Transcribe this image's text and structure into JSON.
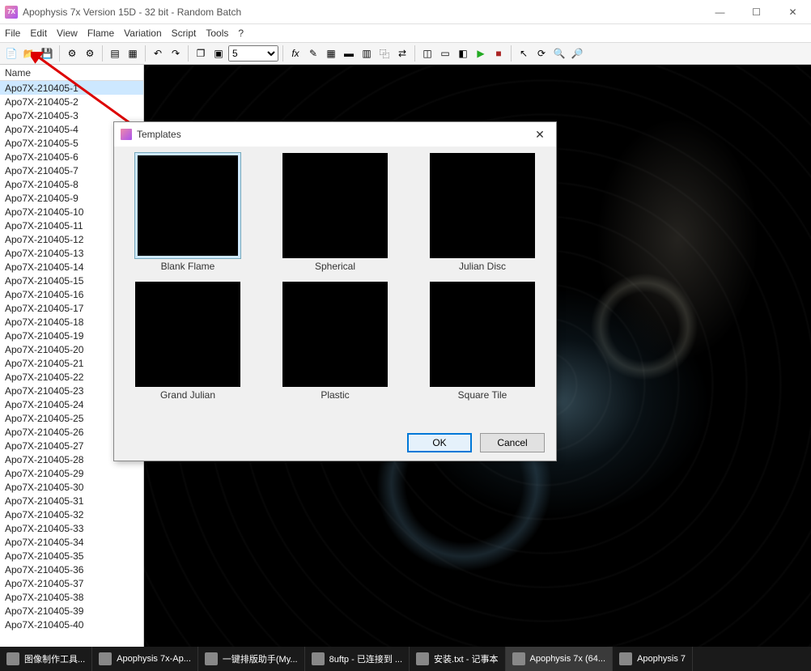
{
  "window": {
    "title": "Apophysis 7x Version 15D  - 32 bit - Random Batch"
  },
  "menubar": [
    "File",
    "Edit",
    "View",
    "Flame",
    "Variation",
    "Script",
    "Tools",
    "?"
  ],
  "toolbar": {
    "zoom_value": "5"
  },
  "sidebar": {
    "header": "Name",
    "selected_index": 0,
    "items": [
      "Apo7X-210405-1",
      "Apo7X-210405-2",
      "Apo7X-210405-3",
      "Apo7X-210405-4",
      "Apo7X-210405-5",
      "Apo7X-210405-6",
      "Apo7X-210405-7",
      "Apo7X-210405-8",
      "Apo7X-210405-9",
      "Apo7X-210405-10",
      "Apo7X-210405-11",
      "Apo7X-210405-12",
      "Apo7X-210405-13",
      "Apo7X-210405-14",
      "Apo7X-210405-15",
      "Apo7X-210405-16",
      "Apo7X-210405-17",
      "Apo7X-210405-18",
      "Apo7X-210405-19",
      "Apo7X-210405-20",
      "Apo7X-210405-21",
      "Apo7X-210405-22",
      "Apo7X-210405-23",
      "Apo7X-210405-24",
      "Apo7X-210405-25",
      "Apo7X-210405-26",
      "Apo7X-210405-27",
      "Apo7X-210405-28",
      "Apo7X-210405-29",
      "Apo7X-210405-30",
      "Apo7X-210405-31",
      "Apo7X-210405-32",
      "Apo7X-210405-33",
      "Apo7X-210405-34",
      "Apo7X-210405-35",
      "Apo7X-210405-36",
      "Apo7X-210405-37",
      "Apo7X-210405-38",
      "Apo7X-210405-39",
      "Apo7X-210405-40"
    ]
  },
  "dialog": {
    "title": "Templates",
    "ok_label": "OK",
    "cancel_label": "Cancel",
    "selected_index": 0,
    "templates": [
      {
        "label": "Blank Flame",
        "thumb": "th-blank"
      },
      {
        "label": "Spherical",
        "thumb": "th-spherical"
      },
      {
        "label": "Julian Disc",
        "thumb": "th-julian"
      },
      {
        "label": "Grand Julian",
        "thumb": "th-grand"
      },
      {
        "label": "Plastic",
        "thumb": "th-plastic"
      },
      {
        "label": "Square Tile",
        "thumb": "th-square"
      }
    ]
  },
  "taskbar": {
    "items": [
      {
        "label": "图像制作工具..."
      },
      {
        "label": "Apophysis 7x-Ap..."
      },
      {
        "label": "一键排版助手(My..."
      },
      {
        "label": "8uftp - 已连接到 ..."
      },
      {
        "label": "安装.txt - 记事本"
      },
      {
        "label": "Apophysis 7x (64..."
      },
      {
        "label": "Apophysis 7"
      }
    ]
  }
}
